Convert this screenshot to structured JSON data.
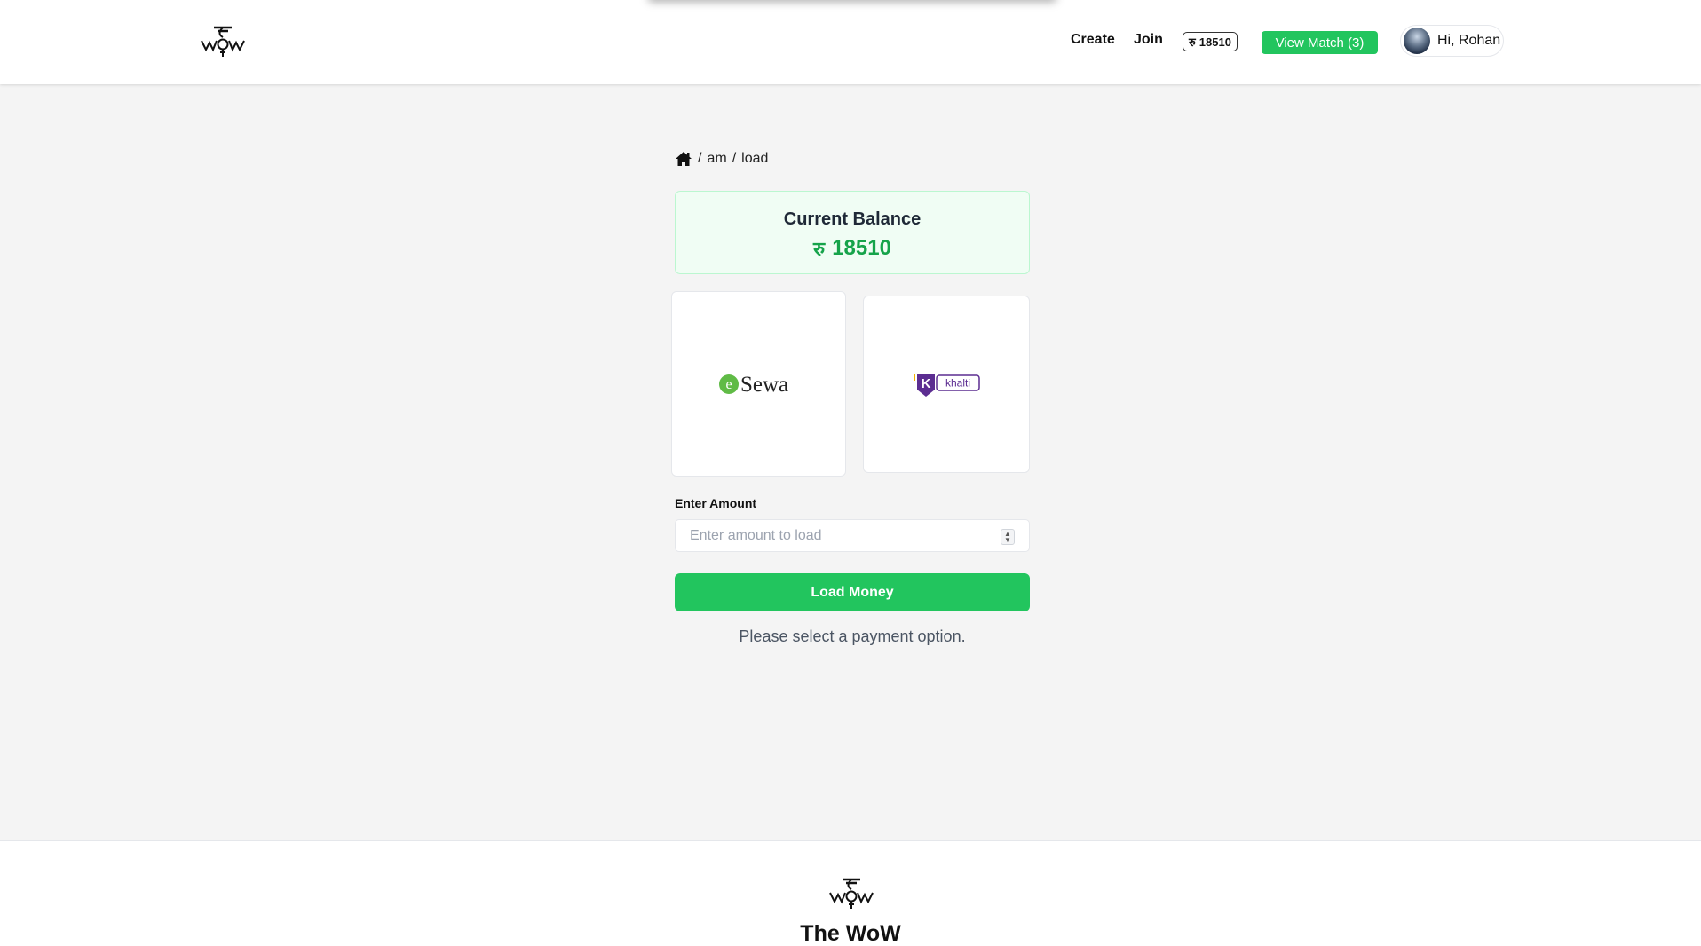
{
  "header": {
    "nav": {
      "create": "Create",
      "join": "Join"
    },
    "balance_chip": {
      "symbol": "रु",
      "amount": "18510"
    },
    "view_match": "View Match (3)",
    "user_greeting": "Hi, Rohan"
  },
  "breadcrumb": {
    "home_icon": "home-icon",
    "separator": "/",
    "items": [
      "am",
      "load"
    ]
  },
  "balance_card": {
    "title": "Current Balance",
    "symbol": "रु",
    "amount": "18510"
  },
  "payment_options": [
    {
      "name": "eSewa",
      "logo_text": "Sewa",
      "logo_letter": "e"
    },
    {
      "name": "khalti",
      "logo_text": "khalti",
      "logo_letter": "K"
    }
  ],
  "amount_field": {
    "label": "Enter Amount",
    "placeholder": "Enter amount to load",
    "value": ""
  },
  "load_button": "Load Money",
  "status_message": "Please select a payment option.",
  "footer": {
    "title": "The WoW"
  },
  "colors": {
    "accent_green": "#22c55e",
    "balance_green": "#16a34a",
    "esewa_green": "#60bb46",
    "khalti_purple": "#5c2d91"
  }
}
